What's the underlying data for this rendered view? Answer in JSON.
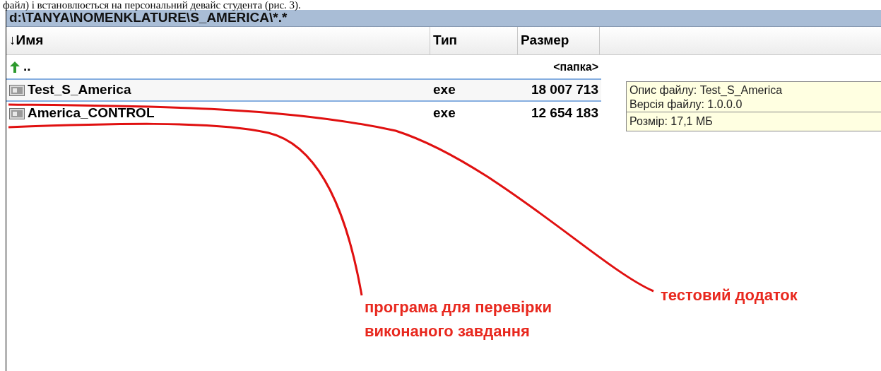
{
  "document_line": "файл) і встановлюється на персональний девайс студента (рис. 3).",
  "panel": {
    "path": "d:\\TANYA\\NOMENKLATURE\\S_AMERICA\\*.*",
    "columns": [
      {
        "label": "↓Имя"
      },
      {
        "label": "Тип"
      },
      {
        "label": "Размер"
      }
    ],
    "rows": [
      {
        "kind": "up",
        "name": "..",
        "type": "",
        "size": "<папка>",
        "selected": false
      },
      {
        "kind": "file",
        "name": "Test_S_America",
        "type": "exe",
        "size": "18 007 713",
        "selected": true
      },
      {
        "kind": "file",
        "name": "America_CONTROL",
        "type": "exe",
        "size": "12 654 183",
        "selected": false
      }
    ]
  },
  "tooltip": {
    "lines": [
      "Опис файлу: Test_S_America",
      "Версія файлу: 1.0.0.0"
    ],
    "footer": "Розмір: 17,1 МБ"
  },
  "annotations": [
    {
      "text": "програма для перевірки виконаного завдання"
    },
    {
      "text": "тестовий додаток"
    }
  ]
}
